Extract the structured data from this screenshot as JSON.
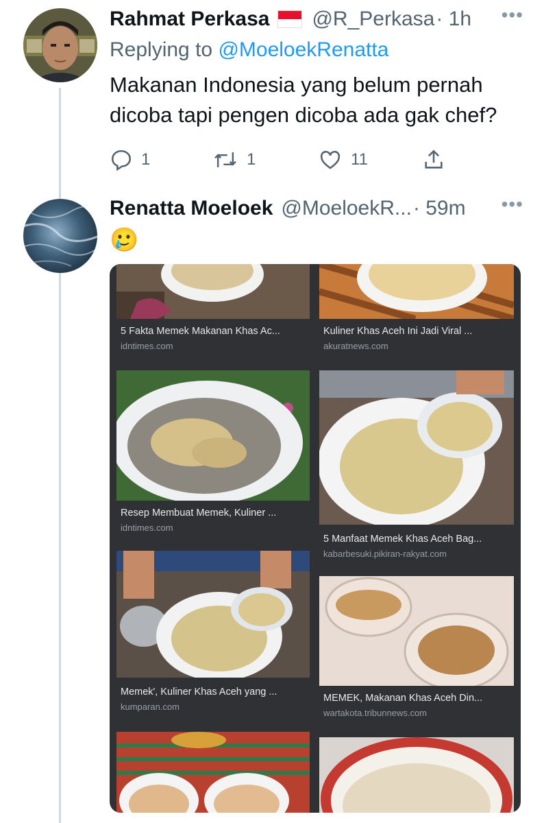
{
  "tweet1": {
    "name": "Rahmat Perkasa",
    "handle": "@R_Perkasa",
    "time": "· 1h",
    "more": "•••",
    "replying_prefix": "Replying to ",
    "replying_to": "@MoeloekRenatta",
    "text_line1": "Makanan Indonesia yang belum pernah",
    "text_line2": "dicoba tapi pengen dicoba ada gak chef?",
    "actions": {
      "replies": "1",
      "retweets": "1",
      "likes": "11"
    }
  },
  "tweet2": {
    "name": "Renatta Moeloek",
    "handle": "@MoeloekR...",
    "time": "· 59m",
    "more": "•••",
    "emoji": "🥲"
  },
  "image_results": [
    {
      "title": "5 Fakta Memek Makanan Khas Ac...",
      "source": "idntimes.com"
    },
    {
      "title": "Kuliner Khas Aceh Ini Jadi Viral ...",
      "source": "akuratnews.com"
    },
    {
      "title": "Resep Membuat Memek, Kuliner ...",
      "source": "idntimes.com"
    },
    {
      "title": "5 Manfaat Memek Khas Aceh Bag...",
      "source": "kabarbesuki.pikiran-rakyat.com"
    },
    {
      "title": "Memek', Kuliner Khas Aceh yang ...",
      "source": "kumparan.com"
    },
    {
      "title": "MEMEK, Makanan Khas Aceh Din...",
      "source": "wartakota.tribunnews.com"
    }
  ],
  "colors": {
    "link": "#1d9bf0",
    "muted": "#536471",
    "card_bg": "#303134",
    "flag_red": "#e8112d"
  }
}
